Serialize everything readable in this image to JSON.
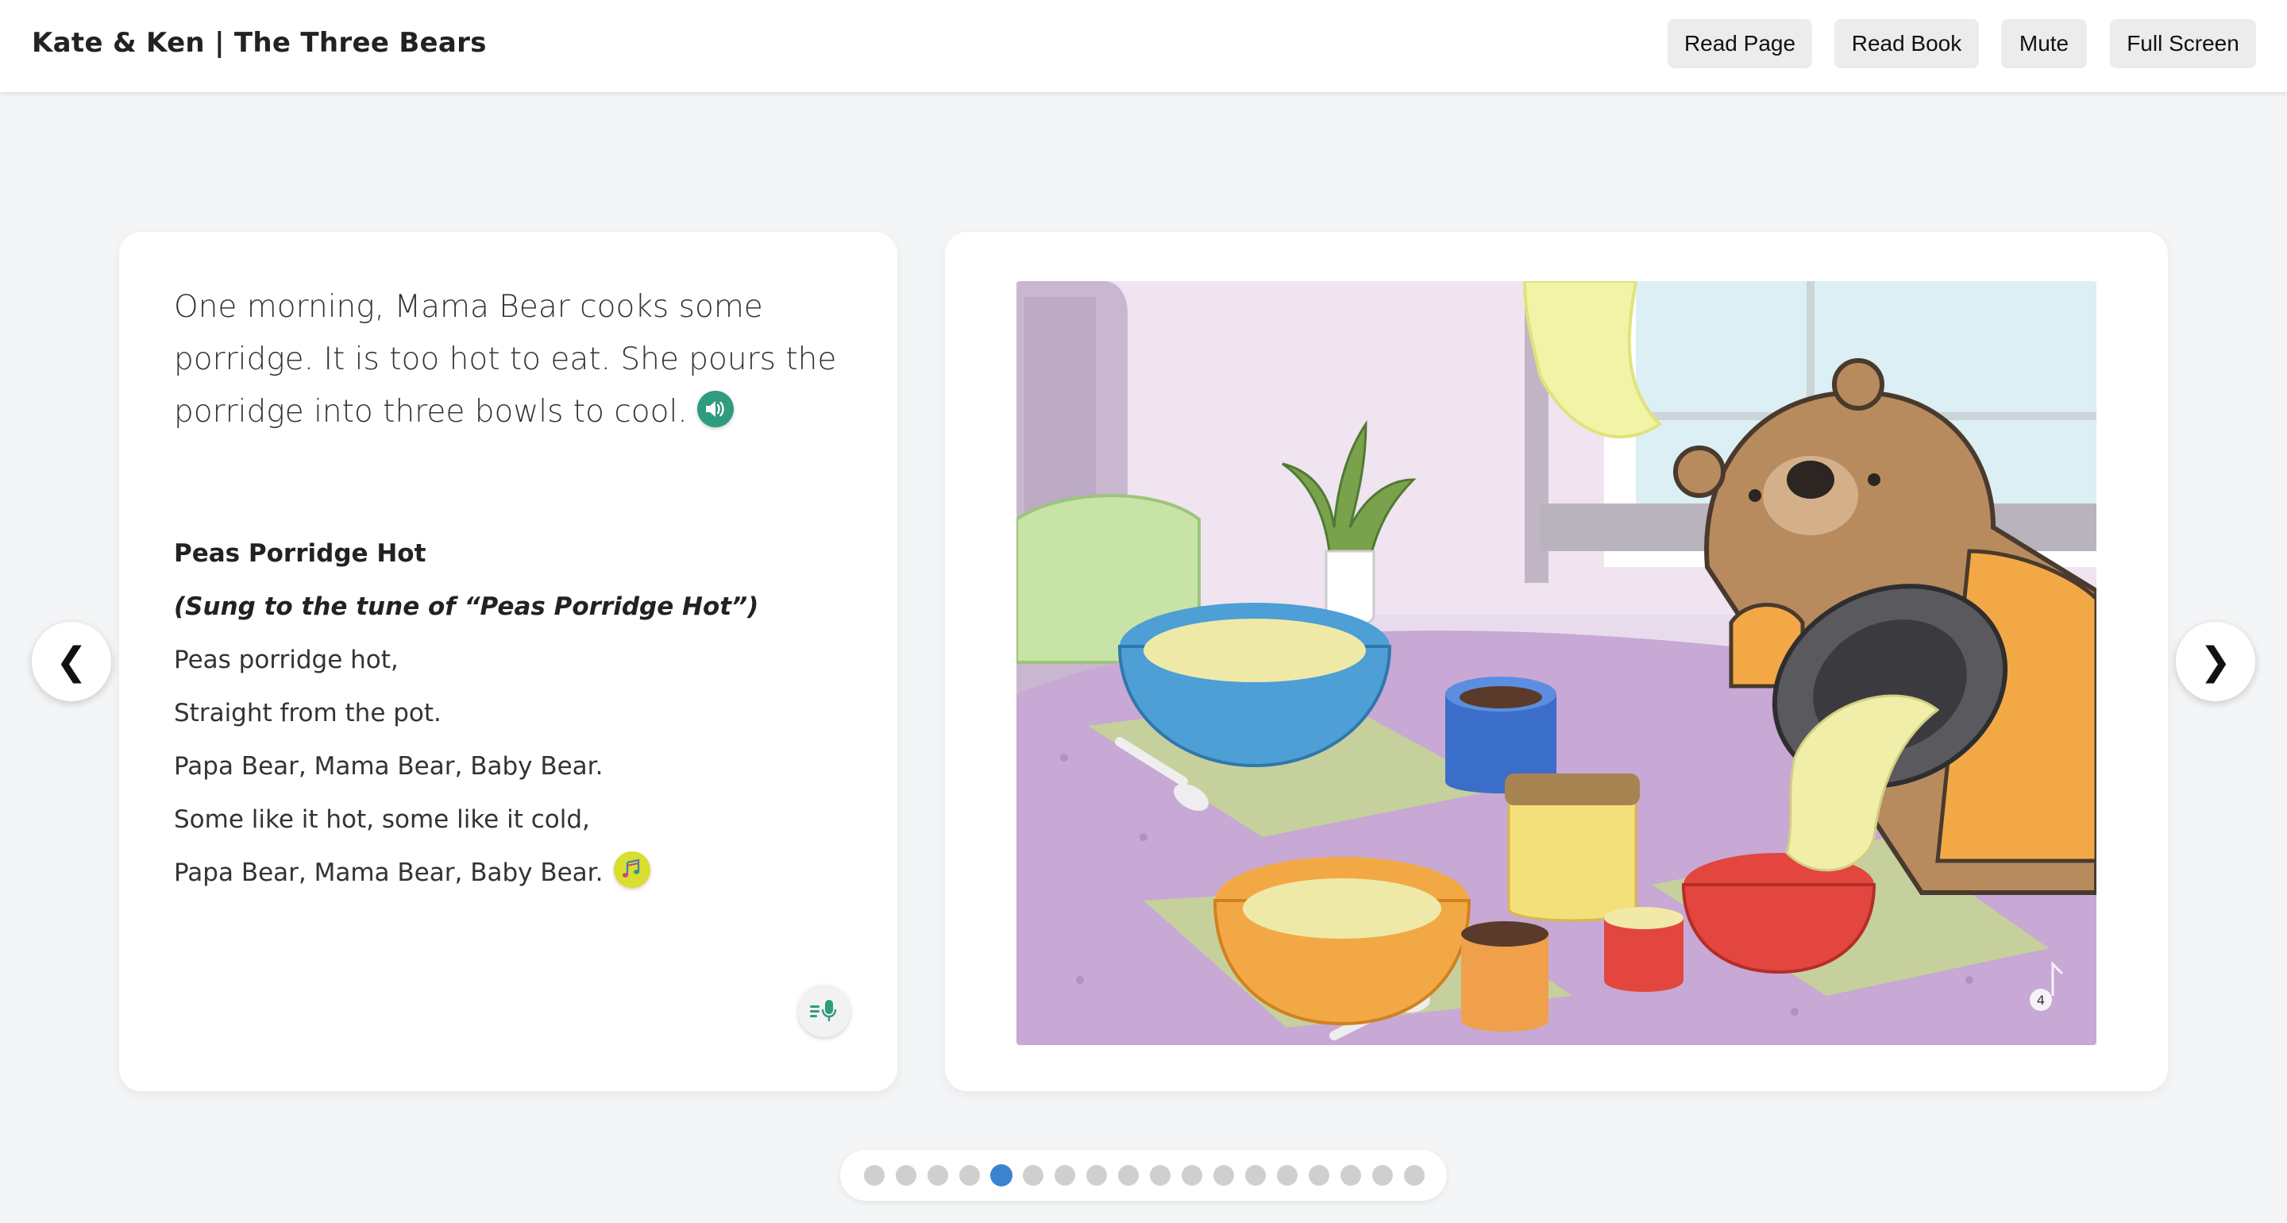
{
  "header": {
    "title": "Kate & Ken | The Three Bears",
    "buttons": {
      "read_page": "Read Page",
      "read_book": "Read Book",
      "mute": "Mute",
      "full_screen": "Full Screen"
    }
  },
  "page": {
    "story_text": "One morning, Mama Bear cooks some porridge. It is too hot to eat. She pours the porridge into three bowls to cool.",
    "song": {
      "title": "Peas Porridge Hot",
      "subtitle": "(Sung to the tune of “Peas Porridge Hot”)",
      "lines": [
        "Peas porridge hot,",
        "Straight from the pot.",
        "Papa Bear, Mama Bear, Baby Bear.",
        "Some like it hot, some like it cold,",
        "Papa Bear, Mama Bear, Baby Bear."
      ]
    },
    "page_number": "4"
  },
  "navigation": {
    "prev_symbol": "❮",
    "next_symbol": "❯",
    "total_pages": 18,
    "current_page_index": 5
  },
  "colors": {
    "audio_button": "#2f9b7f",
    "music_button": "#d9de2f",
    "active_dot": "#3b83d1",
    "inactive_dot": "#cfcfcf"
  },
  "icons": {
    "audio": "speaker-icon",
    "music": "music-notes-icon",
    "mic": "read-aloud-mic-icon",
    "prev": "chevron-left-icon",
    "next": "chevron-right-icon"
  }
}
